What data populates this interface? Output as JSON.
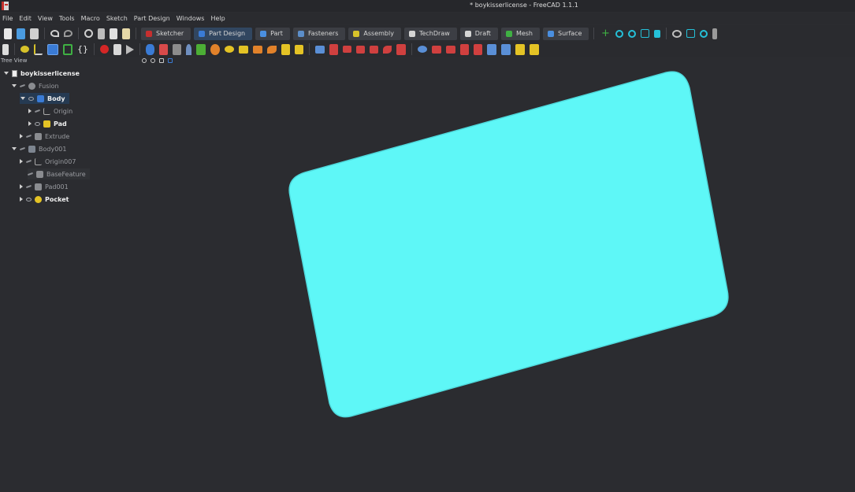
{
  "window": {
    "title": "* boykisserlicense - FreeCAD 1.1.1"
  },
  "menu": [
    "File",
    "Edit",
    "View",
    "Tools",
    "Macro",
    "Sketch",
    "Part Design",
    "Windows",
    "Help"
  ],
  "workbenches": [
    {
      "label": "Sketcher",
      "color": "#c62f2f",
      "active": false
    },
    {
      "label": "Part Design",
      "color": "#3a7bd5",
      "active": true
    },
    {
      "label": "Part",
      "color": "#4a8fe0",
      "active": false
    },
    {
      "label": "Fasteners",
      "color": "#5c8ec9",
      "active": false
    },
    {
      "label": "Assembly",
      "color": "#d7c22a",
      "active": false
    },
    {
      "label": "TechDraw",
      "color": "#d4d4d4",
      "active": false
    },
    {
      "label": "Draft",
      "color": "#d4d4d4",
      "active": false
    },
    {
      "label": "Mesh",
      "color": "#3fb043",
      "active": false
    },
    {
      "label": "Surface",
      "color": "#4a8fe0",
      "active": false
    }
  ],
  "tree": {
    "header": "Tree View",
    "items": [
      {
        "label": "boykisserlicense",
        "depth": 0,
        "expand": "down",
        "kind": "document",
        "style": "bold"
      },
      {
        "label": "Fusion",
        "depth": 1,
        "expand": "down",
        "kind": "part",
        "style": "dim",
        "visible": false
      },
      {
        "label": "Body",
        "depth": 2,
        "expand": "down",
        "kind": "body",
        "style": "selected",
        "visible": true
      },
      {
        "label": "Origin",
        "depth": 3,
        "expand": "right",
        "kind": "origin",
        "style": "dim",
        "visible": false
      },
      {
        "label": "Pad",
        "depth": 3,
        "expand": "right",
        "kind": "pad",
        "style": "normal",
        "visible": true
      },
      {
        "label": "Extrude",
        "depth": 2,
        "expand": "right",
        "kind": "extrude",
        "style": "dim",
        "visible": false
      },
      {
        "label": "Body001",
        "depth": 1,
        "expand": "down",
        "kind": "body",
        "style": "dim",
        "visible": false
      },
      {
        "label": "Origin007",
        "depth": 2,
        "expand": "right",
        "kind": "origin",
        "style": "dim",
        "visible": false
      },
      {
        "label": "BaseFeature",
        "depth": 2,
        "expand": "none",
        "kind": "feature",
        "style": "dim-hl",
        "visible": false
      },
      {
        "label": "Pad001",
        "depth": 2,
        "expand": "right",
        "kind": "pad",
        "style": "dim",
        "visible": false
      },
      {
        "label": "Pocket",
        "depth": 2,
        "expand": "right",
        "kind": "pocket",
        "style": "normal",
        "visible": true
      }
    ]
  },
  "viewport": {
    "background": "#2b2c30",
    "shape_color": "#5ef7f7",
    "shape_edge": "#4fd9dc"
  }
}
